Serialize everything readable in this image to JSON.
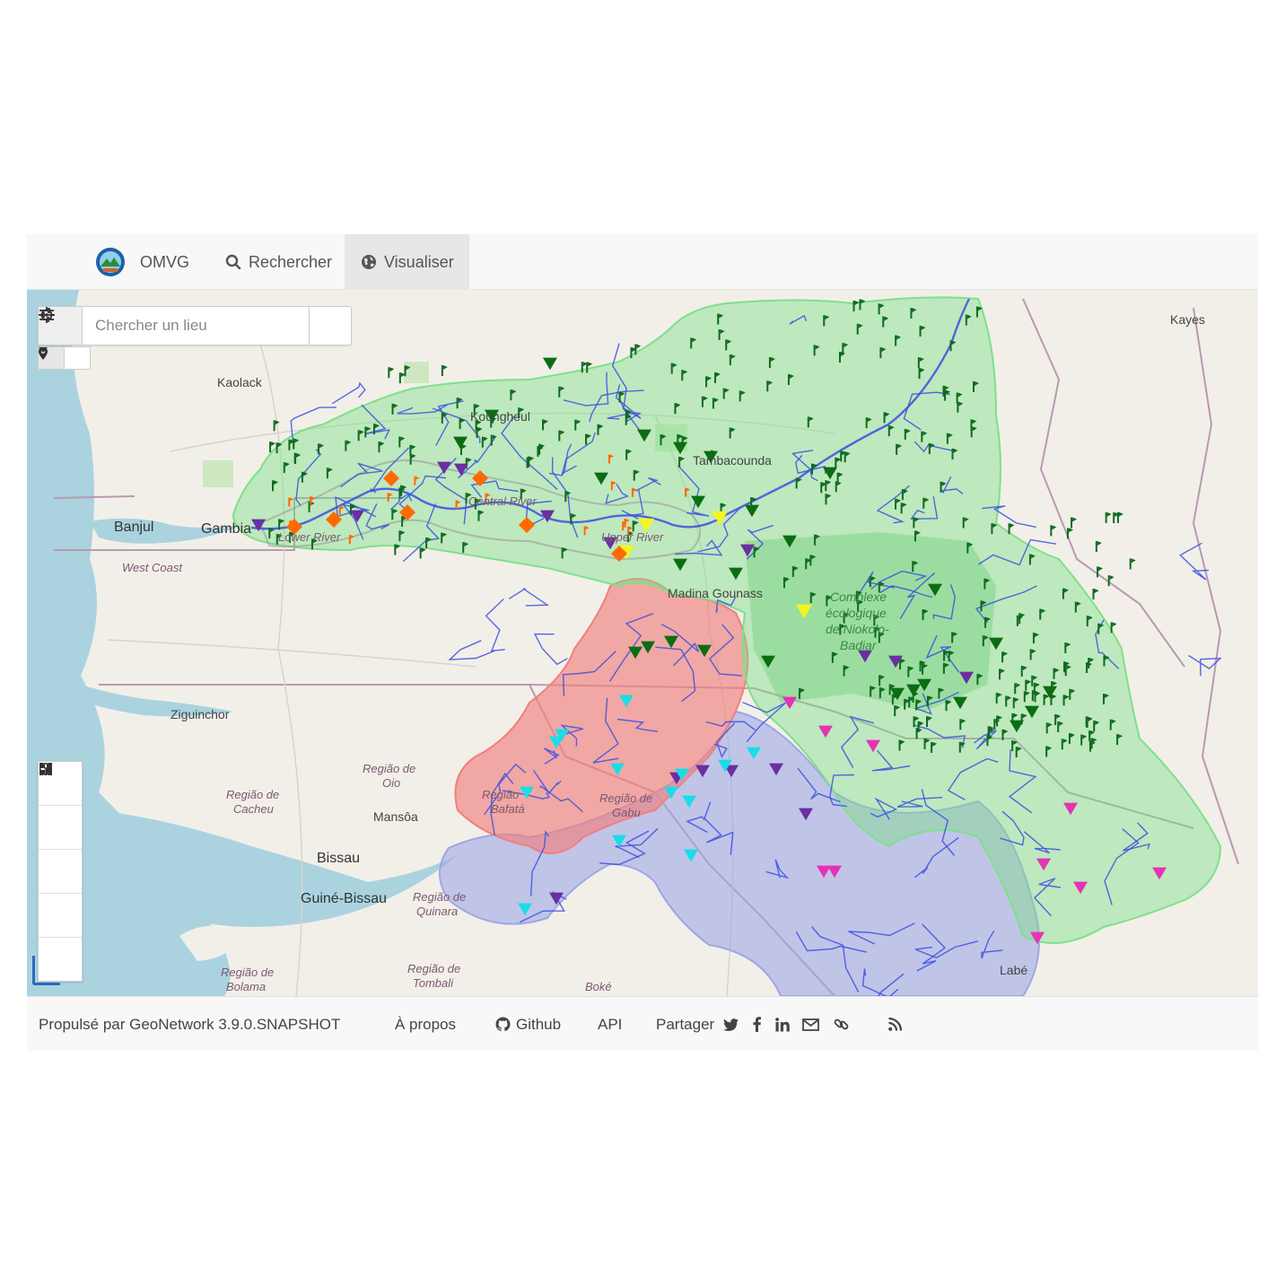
{
  "navbar": {
    "brand": "OMVG",
    "items": [
      {
        "label": "Rechercher",
        "icon": "search-icon",
        "active": false
      },
      {
        "label": "Visualiser",
        "icon": "globe-icon",
        "active": true
      }
    ]
  },
  "map": {
    "search_placeholder": "Chercher un lieu",
    "tools": [
      {
        "name": "zoom-in",
        "icon": "plus-icon"
      },
      {
        "name": "zoom-out",
        "icon": "minus-icon"
      },
      {
        "name": "full-extent",
        "icon": "expand-icon"
      },
      {
        "name": "3d-view",
        "icon": "cube-icon"
      },
      {
        "name": "layers",
        "icon": "grid-icon"
      }
    ],
    "labels": {
      "kaolack": "Kaolack",
      "kayes": "Kayes",
      "banjul": "Banjul",
      "gambia": "Gambia",
      "west_coast": "West Coast",
      "lower_river": "Lower River",
      "central_river": "Central River",
      "upper_river": "Upper River",
      "koungheul": "Koungheul",
      "tambacounda": "Tambacounda",
      "madina": "Madina Gounass",
      "park1": "Complexe",
      "park2": "écologique",
      "park3": "de Niokolo-",
      "park4": "Badiar",
      "ziguinchor": "Ziguinchor",
      "oio1": "Região de",
      "oio2": "Oio",
      "cacheu1": "Região de",
      "cacheu2": "Cacheu",
      "mansoa": "Mansôa",
      "bafata1": "Região",
      "bafata2": "Bafatá",
      "gabu1": "Região de",
      "gabu2": "Gabu",
      "bissau": "Bissau",
      "guinebissau": "Guiné-Bissau",
      "quinara1": "Região de",
      "quinara2": "Quinara",
      "bolama1": "Região de",
      "bolama2": "Bolama",
      "tombali1": "Região de",
      "tombali2": "Tombali",
      "boke": "Boké",
      "labe": "Labé"
    },
    "colors": {
      "green_basin": "#7fe08a",
      "red_basin": "#f08080",
      "blue_basin": "#9fa6e6",
      "river": "#3a4fe0",
      "flag_marker": "#0f6b1e",
      "triangle_dark_green": "#0b6d13",
      "triangle_purple": "#6a2fa0",
      "triangle_cyan": "#19dde8",
      "triangle_magenta": "#e632b4",
      "triangle_yellow": "#f5f51e",
      "diamond_orange": "#ff6a00"
    }
  },
  "footer": {
    "powered": "Propulsé par GeoNetwork 3.9.0.SNAPSHOT",
    "about": "À propos",
    "github": "Github",
    "api": "API",
    "share": "Partager"
  }
}
